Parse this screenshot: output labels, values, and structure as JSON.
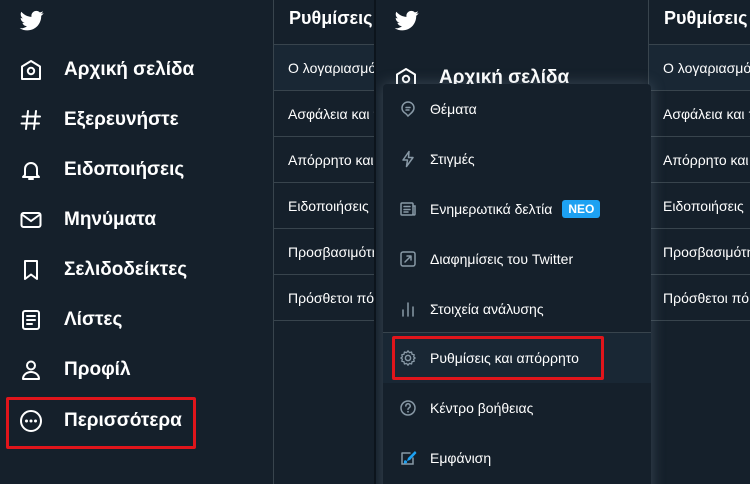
{
  "left": {
    "nav": [
      {
        "label": "Αρχική σελίδα",
        "icon": "home-icon"
      },
      {
        "label": "Εξερευνήστε",
        "icon": "hashtag-icon"
      },
      {
        "label": "Ειδοποιήσεις",
        "icon": "bell-icon"
      },
      {
        "label": "Μηνύματα",
        "icon": "mail-icon"
      },
      {
        "label": "Σελιδοδείκτες",
        "icon": "bookmark-icon"
      },
      {
        "label": "Λίστες",
        "icon": "list-icon"
      },
      {
        "label": "Προφίλ",
        "icon": "profile-icon"
      },
      {
        "label": "Περισσότερα",
        "icon": "more-icon"
      }
    ]
  },
  "settings": {
    "title": "Ρυθμίσεις και απόρρητο",
    "rows": [
      "Ο λογαριασμός σας",
      "Ασφάλεια και πρόσβαση λογαριασμού",
      "Απόρρητο και ασφάλεια",
      "Ειδοποιήσεις",
      "Προσβασιμότητα, προβολή και γλώσσες",
      "Πρόσθετοι πόροι"
    ]
  },
  "menu": {
    "partial_nav_label": "Αρχική σελίδα",
    "items": [
      {
        "label": "Θέματα",
        "icon": "topics-icon"
      },
      {
        "label": "Στιγμές",
        "icon": "moments-icon"
      },
      {
        "label": "Ενημερωτικά δελτία",
        "icon": "newsletters-icon",
        "badge": "ΝΕΟ"
      },
      {
        "label": "Διαφημίσεις του Twitter",
        "icon": "ads-icon"
      },
      {
        "label": "Στοιχεία ανάλυσης",
        "icon": "analytics-icon"
      },
      {
        "label": "Ρυθμίσεις και απόρρητο",
        "icon": "settings-gear-icon"
      },
      {
        "label": "Κέντρο βοήθειας",
        "icon": "help-icon"
      },
      {
        "label": "Εμφάνιση",
        "icon": "display-icon"
      }
    ]
  },
  "colors": {
    "background": "#15202b",
    "divider": "#38444d",
    "accent": "#1da1f2",
    "highlight": "#e0151b"
  }
}
